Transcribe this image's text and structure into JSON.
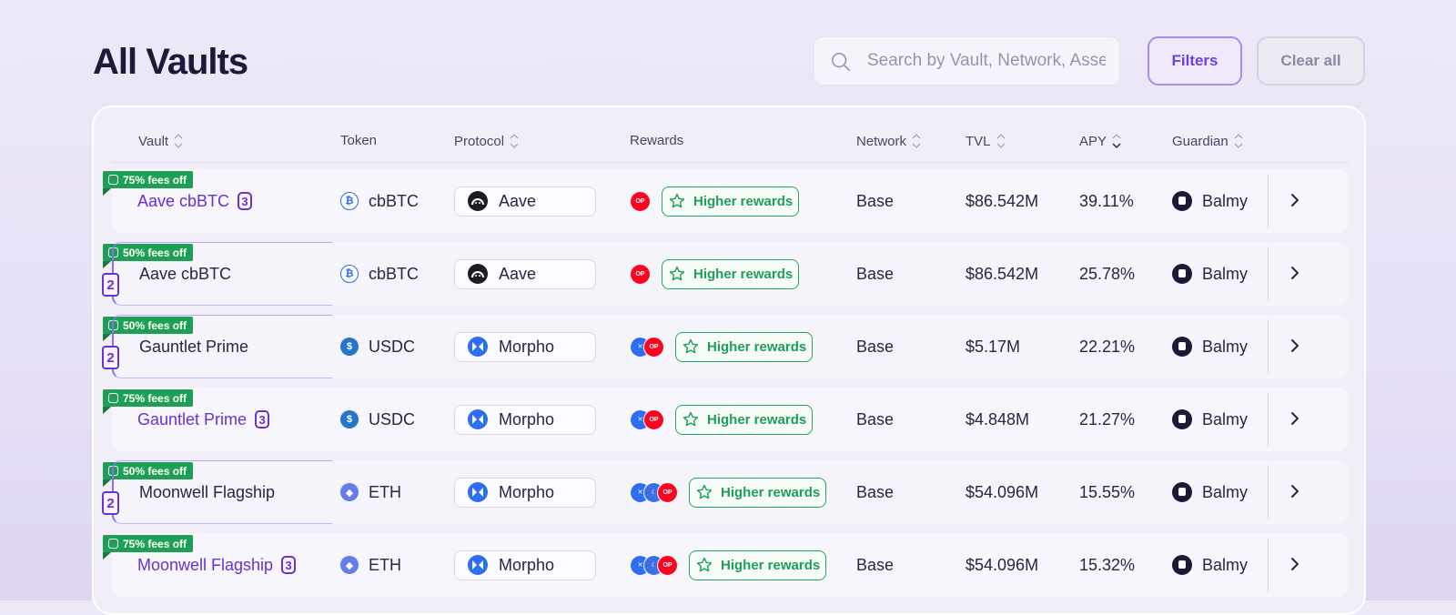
{
  "page": {
    "title": "All Vaults"
  },
  "search": {
    "placeholder": "Search by Vault, Network, Asset"
  },
  "toolbar": {
    "filters_label": "Filters",
    "clear_label": "Clear all"
  },
  "colors": {
    "accent": "#6a2fd6",
    "rewards_green": "#1f9f55",
    "op_red": "#ff0420"
  },
  "table": {
    "headers": {
      "vault": "Vault",
      "token": "Token",
      "protocol": "Protocol",
      "rewards": "Rewards",
      "network": "Network",
      "tvl": "TVL",
      "apy": "APY",
      "guardian": "Guardian"
    },
    "rows": [
      {
        "fee": "75% fees off",
        "vault": "Aave cbBTC",
        "tier": "3",
        "highlight": true,
        "token": "cbBTC",
        "token_icon": "bitcoin-icon",
        "protocol": "Aave",
        "protocol_icon": "aave-icon",
        "reward_icons": [
          "op-icon"
        ],
        "rewards_label": "Higher rewards",
        "network": "Base",
        "tvl": "$86.542M",
        "apy": "39.11%",
        "guardian": "Balmy"
      },
      {
        "fee": "50% fees off",
        "vault": "Aave cbBTC",
        "tier": "2",
        "highlight": false,
        "token": "cbBTC",
        "token_icon": "bitcoin-icon",
        "protocol": "Aave",
        "protocol_icon": "aave-icon",
        "reward_icons": [
          "op-icon"
        ],
        "rewards_label": "Higher rewards",
        "network": "Base",
        "tvl": "$86.542M",
        "apy": "25.78%",
        "guardian": "Balmy"
      },
      {
        "fee": "50% fees off",
        "vault": "Gauntlet Prime",
        "tier": "2",
        "highlight": false,
        "token": "USDC",
        "token_icon": "usdc-icon",
        "protocol": "Morpho",
        "protocol_icon": "morpho-icon",
        "reward_icons": [
          "morpho-icon",
          "op-icon"
        ],
        "rewards_label": "Higher rewards",
        "network": "Base",
        "tvl": "$5.17M",
        "apy": "22.21%",
        "guardian": "Balmy"
      },
      {
        "fee": "75% fees off",
        "vault": "Gauntlet Prime",
        "tier": "3",
        "highlight": true,
        "token": "USDC",
        "token_icon": "usdc-icon",
        "protocol": "Morpho",
        "protocol_icon": "morpho-icon",
        "reward_icons": [
          "morpho-icon",
          "op-icon"
        ],
        "rewards_label": "Higher rewards",
        "network": "Base",
        "tvl": "$4.848M",
        "apy": "21.27%",
        "guardian": "Balmy"
      },
      {
        "fee": "50% fees off",
        "vault": "Moonwell Flagship",
        "tier": "2",
        "highlight": false,
        "token": "ETH",
        "token_icon": "eth-icon",
        "protocol": "Morpho",
        "protocol_icon": "morpho-icon",
        "reward_icons": [
          "morpho-icon",
          "moonwell-icon",
          "op-icon"
        ],
        "rewards_label": "Higher rewards",
        "network": "Base",
        "tvl": "$54.096M",
        "apy": "15.55%",
        "guardian": "Balmy"
      },
      {
        "fee": "75% fees off",
        "vault": "Moonwell Flagship",
        "tier": "3",
        "highlight": true,
        "token": "ETH",
        "token_icon": "eth-icon",
        "protocol": "Morpho",
        "protocol_icon": "morpho-icon",
        "reward_icons": [
          "morpho-icon",
          "moonwell-icon",
          "op-icon"
        ],
        "rewards_label": "Higher rewards",
        "network": "Base",
        "tvl": "$54.096M",
        "apy": "15.32%",
        "guardian": "Balmy"
      }
    ]
  }
}
